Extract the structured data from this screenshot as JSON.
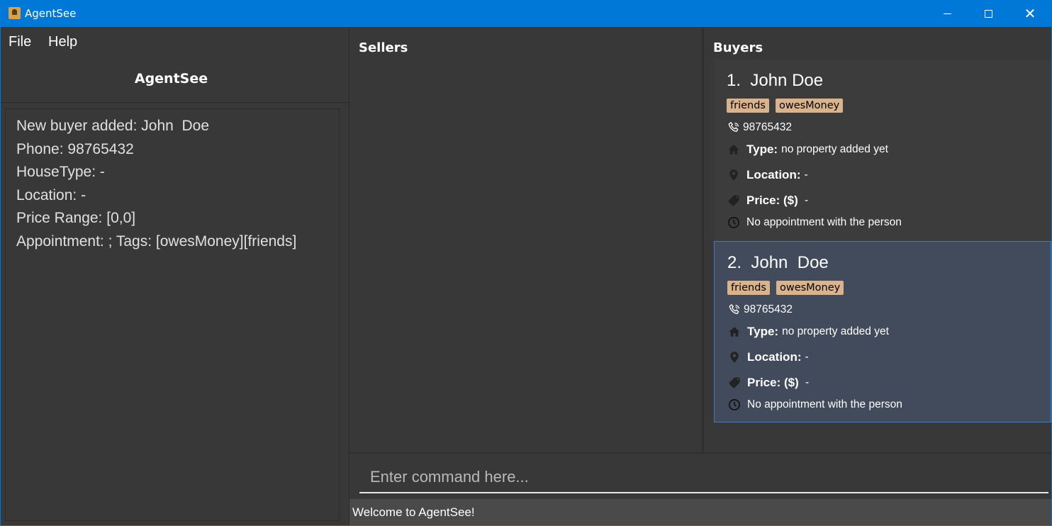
{
  "window": {
    "title": "AgentSee",
    "icon": "contact-card-icon",
    "controls": [
      "minimize-icon",
      "maximize-icon",
      "close-icon"
    ]
  },
  "menu": {
    "file": "File",
    "help": "Help"
  },
  "header": {
    "title": "AgentSee"
  },
  "result_display": {
    "lines": [
      "New buyer added: John  Doe",
      "Phone: 98765432",
      "HouseType: -",
      "Location: -",
      "Price Range: [0,0]",
      "Appointment: ; Tags: [owesMoney][friends]"
    ]
  },
  "sellers": {
    "title": "Sellers",
    "items": []
  },
  "buyers": {
    "title": "Buyers",
    "labels": {
      "type": "Type:",
      "location": "Location:",
      "price": "Price: ($)"
    },
    "items": [
      {
        "name": "1.  John Doe",
        "tags": [
          "friends",
          "owesMoney"
        ],
        "phone": "98765432",
        "type": "no property added yet",
        "location": "-",
        "price": " -",
        "appointment": "No appointment with the person",
        "selected": false
      },
      {
        "name": "2.  John  Doe",
        "tags": [
          "friends",
          "owesMoney"
        ],
        "phone": "98765432",
        "type": "no property added yet",
        "location": "-",
        "price": " -",
        "appointment": "No appointment with the person",
        "selected": true
      }
    ]
  },
  "command": {
    "placeholder": "Enter command here...",
    "value": ""
  },
  "status": {
    "text": "Welcome to AgentSee!"
  },
  "colors": {
    "titlebar": "#0078d7",
    "background": "#383838",
    "card": "#3c3c3c",
    "selected_card": "#414b5c",
    "selected_border": "#3d7cb8",
    "tag": "#d9b38c"
  }
}
